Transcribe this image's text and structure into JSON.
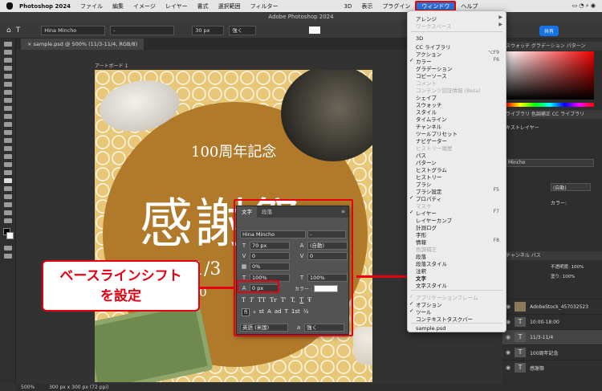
{
  "menubar": {
    "app": "Photoshop 2024",
    "items": [
      "ファイル",
      "編集",
      "イメージ",
      "レイヤー",
      "書式",
      "選択範囲",
      "フィルター",
      "3D",
      "表示",
      "プラグイン",
      "ウィンドウ",
      "ヘルプ"
    ]
  },
  "window_title": "Adobe Photoshop 2024",
  "options": {
    "font": "Hina Mincho",
    "style": "-",
    "size": "30 px",
    "aa": "強く"
  },
  "share_label": "共有",
  "doc_tab": "sample.psd @ 500% (11/3-11/4, RGB/8)",
  "artboard_label": "アートボード 1",
  "artwork": {
    "line1": "100周年記念",
    "line2": "感謝祭",
    "line3": "11/3",
    "line4": "10:0"
  },
  "status": {
    "zoom": "500%",
    "size": "300 px x 300 px (72 ppi)"
  },
  "char_panel": {
    "tabs": [
      "文字",
      "段落"
    ],
    "font": "Hina Mincho",
    "style": "-",
    "size": "70 px",
    "leading": "(自動)",
    "kerning": "0",
    "tracking": "0",
    "tsume": "0%",
    "vscale": "100%",
    "hscale": "100%",
    "baseline": "0 px",
    "color_label": "カラー :",
    "styles": [
      "T",
      "T",
      "TT",
      "Tr",
      "T'",
      "T,",
      "T",
      "Ŧ"
    ],
    "liga": [
      "fi",
      "ℴ",
      "st",
      "A",
      "ad",
      "T",
      "1st",
      "½"
    ],
    "language": "英語 (米国)",
    "aa": "強く"
  },
  "callout": {
    "line1": "ベースラインシフト",
    "line2": "を設定"
  },
  "window_menu": {
    "items": [
      {
        "label": "アレンジ",
        "arrow": true
      },
      {
        "label": "ワークスペース",
        "arrow": true,
        "disabled": true
      },
      {
        "label": "3D"
      },
      {
        "label": "CC ライブラリ"
      },
      {
        "label": "アクション",
        "shortcut": "⌥F9"
      },
      {
        "label": "カラー",
        "shortcut": "F6",
        "checked": true
      },
      {
        "label": "グラデーション"
      },
      {
        "label": "コピーソース"
      },
      {
        "label": "コメント",
        "disabled": true
      },
      {
        "label": "コンテンツ認証情報 (Beta)",
        "disabled": true
      },
      {
        "label": "シェイプ"
      },
      {
        "label": "スウォッチ"
      },
      {
        "label": "スタイル"
      },
      {
        "label": "タイムライン"
      },
      {
        "label": "チャンネル"
      },
      {
        "label": "ツールプリセット"
      },
      {
        "label": "ナビゲーター"
      },
      {
        "label": "ヒストリー履歴",
        "disabled": true
      },
      {
        "label": "パス"
      },
      {
        "label": "パターン"
      },
      {
        "label": "ヒストグラム"
      },
      {
        "label": "ヒストリー"
      },
      {
        "label": "ブラシ"
      },
      {
        "label": "ブラシ設定",
        "shortcut": "F5"
      },
      {
        "label": "プロパティ",
        "checked": true
      },
      {
        "label": "マスク",
        "disabled": true
      },
      {
        "label": "レイヤー",
        "shortcut": "F7",
        "checked": true
      },
      {
        "label": "レイヤーカンプ"
      },
      {
        "label": "計測ログ"
      },
      {
        "label": "字形"
      },
      {
        "label": "情報",
        "shortcut": "F8"
      },
      {
        "label": "色調補正",
        "disabled": true
      },
      {
        "label": "段落"
      },
      {
        "label": "段落スタイル"
      },
      {
        "label": "注釈"
      },
      {
        "label": "文字"
      },
      {
        "label": "文字スタイル"
      },
      {
        "label": "アプリケーションフレーム",
        "checked": true,
        "disabled": true
      },
      {
        "label": "オプション",
        "checked": true
      },
      {
        "label": "ツール",
        "checked": true
      },
      {
        "label": "コンテキストタスクバー"
      },
      {
        "label": "sample.psd"
      }
    ]
  },
  "dock": {
    "tabs1": "スウォッチ  グラデーション  パターン",
    "tabs2": "ライブラリ  色調補正  CC ライブラリ",
    "text_layer": "キストレイヤー",
    "font": "Mincho",
    "leading": "(自動)",
    "color_label": "カラー:",
    "tabs3": "チャンネル  パス",
    "opacity": "不透明度: 100%",
    "fill": "塗り: 100%",
    "layers": [
      "AdobeStock_457032523",
      "10:00-18:00",
      "11/3-11/4",
      "100周年記念",
      "感謝祭"
    ]
  }
}
